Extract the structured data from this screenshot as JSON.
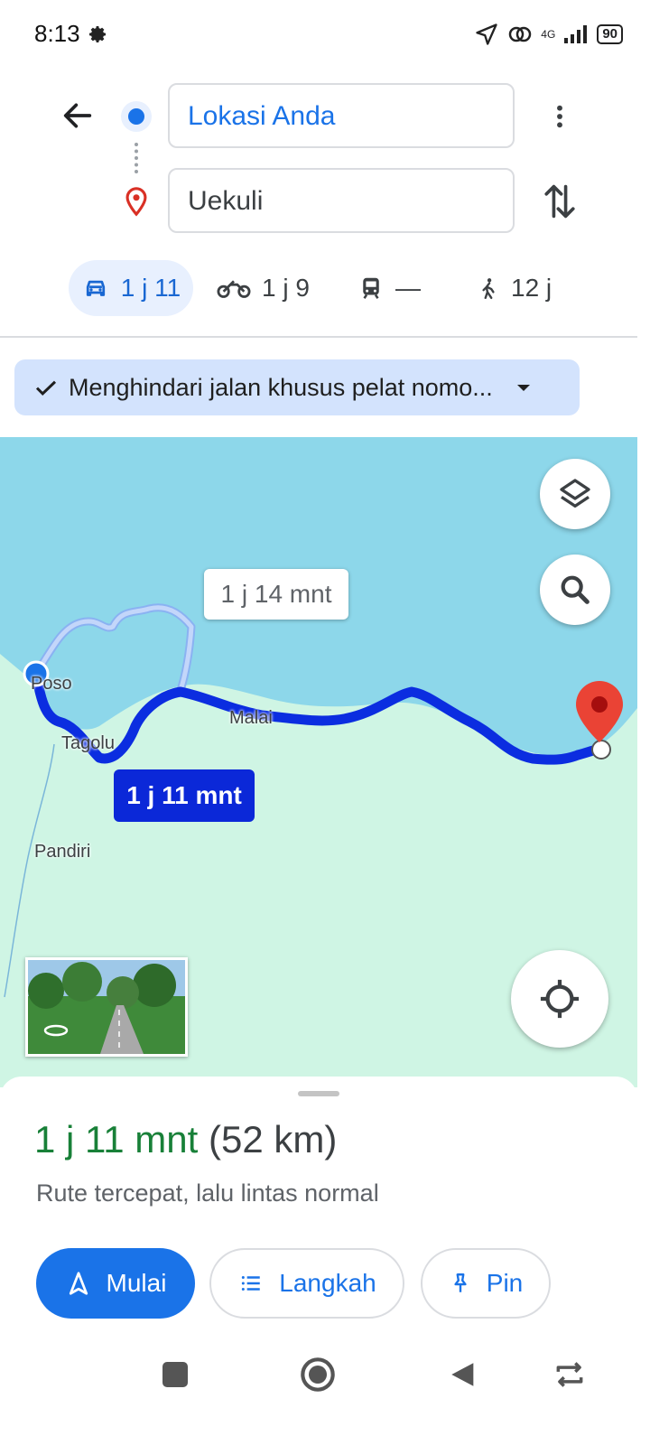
{
  "status": {
    "time": "8:13",
    "network": "4G",
    "battery": "90"
  },
  "search": {
    "origin": "Lokasi Anda",
    "destination": "Uekuli"
  },
  "modes": [
    {
      "icon": "car-icon",
      "label": "1 j 11"
    },
    {
      "icon": "motorcycle-icon",
      "label": "1 j 9"
    },
    {
      "icon": "train-icon",
      "label": "—"
    },
    {
      "icon": "walk-icon",
      "label": "12 j"
    }
  ],
  "filter": {
    "label": "Menghindari jalan khusus pelat nomo..."
  },
  "map": {
    "callout_alt": "1 j 14 mnt",
    "callout_main": "1 j 11 mnt",
    "places": {
      "poso": "Poso",
      "tagolu": "Tagolu",
      "malai": "Malai",
      "pandiri": "Pandiri"
    },
    "colors": {
      "water": "#8dd7ea",
      "land": "#cff5e4",
      "route": "#0b2de0",
      "alt_route": "#a9c3f7",
      "pin": "#ea4335"
    }
  },
  "sheet": {
    "duration": "1 j 11 mnt",
    "distance": "(52 km)",
    "subtitle": "Rute tercepat, lalu lintas normal",
    "start_label": "Mulai",
    "steps_label": "Langkah",
    "pin_label": "Pin"
  }
}
